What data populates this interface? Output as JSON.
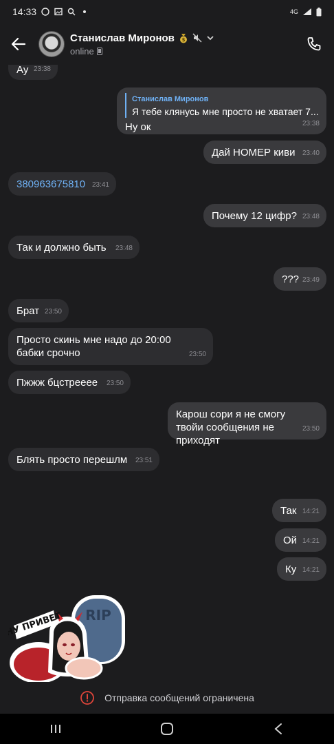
{
  "status_bar": {
    "time": "14:33",
    "network": "4G"
  },
  "header": {
    "name": "Станислав Миронов",
    "status": "online"
  },
  "messages": [
    {
      "dir": "in",
      "text": "Ау",
      "time": "23:38"
    },
    {
      "dir": "out",
      "reply_name": "Станислав Миронов",
      "reply_text": "Я тебе клянусь мне просто не хватает 7...",
      "text": "Ну ок",
      "time": "23:38"
    },
    {
      "dir": "out",
      "text": "Дай НОМЕР киви",
      "time": "23:40"
    },
    {
      "dir": "in",
      "text": "380963675810",
      "time": "23:41"
    },
    {
      "dir": "out",
      "text": "Почему 12 цифр?",
      "time": "23:48"
    },
    {
      "dir": "in",
      "text": "Так и должно быть",
      "time": "23:48"
    },
    {
      "dir": "out",
      "text": "???",
      "time": "23:49"
    },
    {
      "dir": "in",
      "text": "Брат",
      "time": "23:50"
    },
    {
      "dir": "in",
      "text": "Просто скинь мне надо до 20:00 бабки срочно",
      "time": "23:50"
    },
    {
      "dir": "in",
      "text": "Пжжж бцстреееe",
      "time": "23:50"
    },
    {
      "dir": "out",
      "text": "Карош сори я не смогу твойи сообщения не приходят",
      "time": "23:50"
    },
    {
      "dir": "in",
      "text": "Блять просто перешлм",
      "time": "23:51"
    },
    {
      "dir": "out",
      "text": "Так",
      "time": "14:21"
    },
    {
      "dir": "out",
      "text": "Ой",
      "time": "14:21"
    },
    {
      "dir": "out",
      "text": "Ку",
      "time": "14:21"
    }
  ],
  "sticker": {
    "caption": "НУ ПРИВЕТ",
    "tombstone": "RIP"
  },
  "footer": {
    "restricted_text": "Отправка сообщений ограничена"
  },
  "colors": {
    "background": "#1c1c1e",
    "incoming": "#2d2d30",
    "outgoing": "#3a3a3d",
    "link": "#6fb1f5",
    "warning": "#e0453a"
  }
}
